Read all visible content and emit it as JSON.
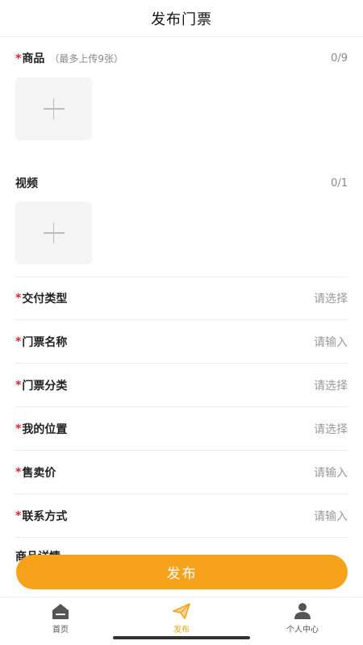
{
  "header": {
    "title": "发布门票"
  },
  "goods": {
    "required_mark": "*",
    "label": "商品",
    "hint": "（最多上传9张）",
    "count": "0/9"
  },
  "video": {
    "label": "视频",
    "count": "0/1"
  },
  "form": {
    "rows": [
      {
        "required_mark": "*",
        "label": "交付类型",
        "value": "请选择"
      },
      {
        "required_mark": "*",
        "label": "门票名称",
        "value": "请输入"
      },
      {
        "required_mark": "*",
        "label": "门票分类",
        "value": "请选择"
      },
      {
        "required_mark": "*",
        "label": "我的位置",
        "value": "请选择"
      },
      {
        "required_mark": "*",
        "label": "售卖价",
        "value": "请输入"
      },
      {
        "required_mark": "*",
        "label": "联系方式",
        "value": "请输入"
      }
    ],
    "partial_label": "商品详情"
  },
  "publish_button": {
    "label": "发布"
  },
  "tabbar": {
    "items": [
      {
        "label": "首页",
        "icon": "home-icon",
        "active": false
      },
      {
        "label": "发布",
        "icon": "paper-plane-icon",
        "active": true
      },
      {
        "label": "个人中心",
        "icon": "person-icon",
        "active": false
      }
    ]
  },
  "colors": {
    "accent": "#f7a21b",
    "required": "#e0212f",
    "placeholder": "#999999"
  }
}
